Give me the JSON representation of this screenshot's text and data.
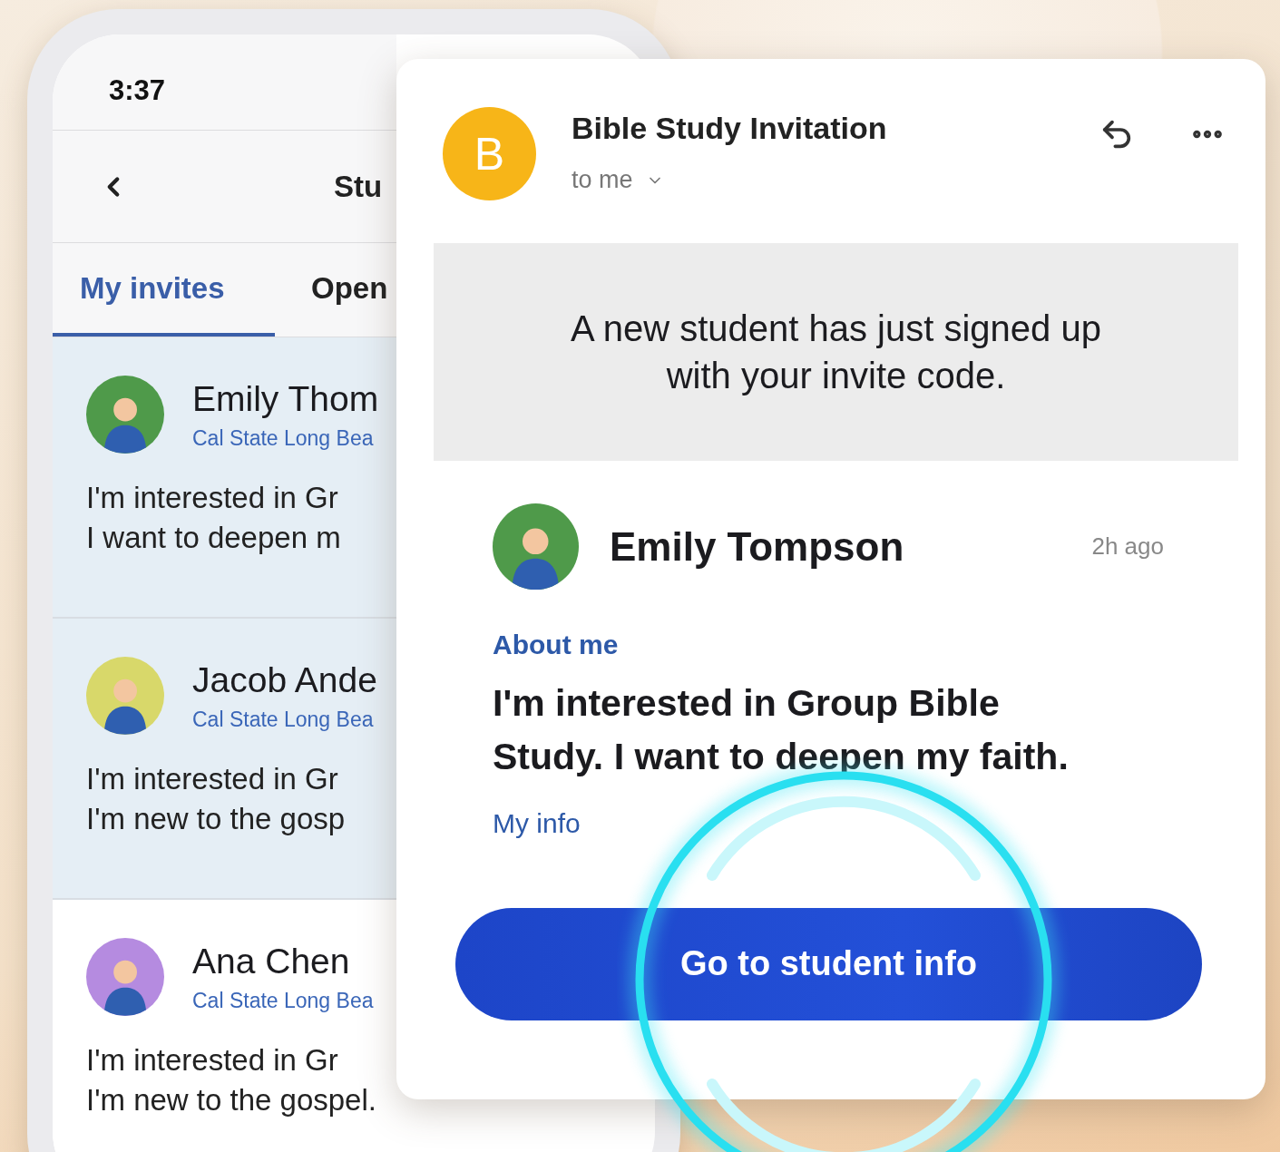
{
  "phone": {
    "status_time": "3:37",
    "title": "Stu",
    "tabs": [
      {
        "label": "My invites",
        "selected": true
      },
      {
        "label": "Open",
        "selected": false
      }
    ],
    "invites": [
      {
        "name": "Emily Thom",
        "school": "Cal State Long Bea",
        "lines": [
          "I'm interested in Gr",
          "I want to deepen m"
        ],
        "color": "#4f9a4a",
        "highlighted": true
      },
      {
        "name": "Jacob Ande",
        "school": "Cal State Long Bea",
        "lines": [
          "I'm interested in Gr",
          "I'm new to the gosp"
        ],
        "color": "#d8d86a",
        "highlighted": true
      },
      {
        "name": "Ana Chen",
        "school": "Cal State Long Bea",
        "lines": [
          "I'm interested in Gr",
          "I'm new to the gospel."
        ],
        "color": "#b58be0",
        "highlighted": false
      }
    ]
  },
  "email": {
    "avatar_letter": "B",
    "subject": "Bible Study Invitation",
    "recipient": "to me",
    "banner": "A new student has just signed up with your invite code.",
    "student": {
      "name": "Emily Tompson",
      "time": "2h ago",
      "color": "#4f9a4a"
    },
    "about_label": "About me",
    "about_text": "I'm interested in Group Bible Study. I want to deepen my faith.",
    "info_label": "My info",
    "button": "Go to student info"
  }
}
